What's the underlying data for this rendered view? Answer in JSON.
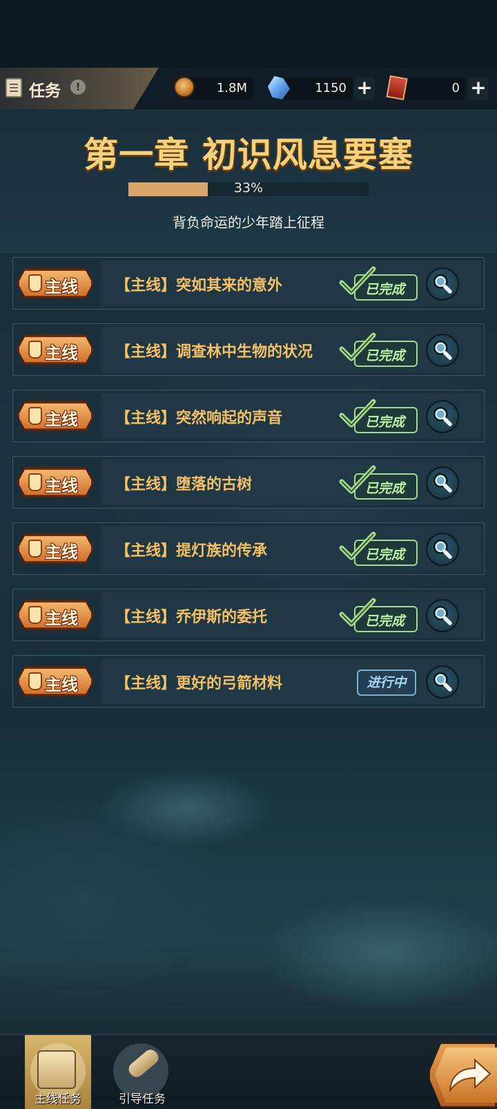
{
  "header": {
    "title": "任务",
    "info_icon": "!",
    "resources": [
      {
        "name": "coin",
        "icon": "coin-icon",
        "value": "1.8M"
      },
      {
        "name": "crystal",
        "icon": "crystal-icon",
        "value": "1150"
      },
      {
        "name": "ticket",
        "icon": "ticket-icon",
        "value": "0"
      }
    ],
    "plus_label": "+"
  },
  "chapter": {
    "title": "第一章 初识风息要塞",
    "progress_percent": 33,
    "progress_text": "33%",
    "subtitle": "背负命运的少年踏上征程"
  },
  "quests": [
    {
      "badge": "主线",
      "name": "【主线】突如其来的意外",
      "status": "已完成",
      "state": "done"
    },
    {
      "badge": "主线",
      "name": "【主线】调查林中生物的状况",
      "status": "已完成",
      "state": "done"
    },
    {
      "badge": "主线",
      "name": "【主线】突然响起的声音",
      "status": "已完成",
      "state": "done"
    },
    {
      "badge": "主线",
      "name": "【主线】堕落的古树",
      "status": "已完成",
      "state": "done"
    },
    {
      "badge": "主线",
      "name": "【主线】提灯族的传承",
      "status": "已完成",
      "state": "done"
    },
    {
      "badge": "主线",
      "name": "【主线】乔伊斯的委托",
      "status": "已完成",
      "state": "done"
    },
    {
      "badge": "主线",
      "name": "【主线】更好的弓箭材料",
      "status": "进行中",
      "state": "in_progress"
    }
  ],
  "bottom_tabs": [
    {
      "label": "主线任务",
      "icon": "scroll-icon",
      "active": true
    },
    {
      "label": "引导任务",
      "icon": "bone-icon",
      "active": false
    }
  ],
  "colors": {
    "quest_name": "#f3c062",
    "done": "#bff0a0",
    "in_progress": "#a8d4f0",
    "chapter_title": "#f5d27a"
  }
}
